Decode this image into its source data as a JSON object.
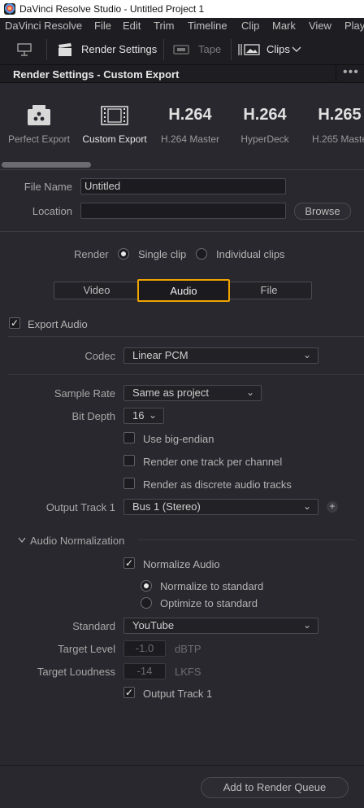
{
  "window": {
    "title": "DaVinci Resolve Studio - Untitled Project 1"
  },
  "menu": [
    "DaVinci Resolve",
    "File",
    "Edit",
    "Trim",
    "Timeline",
    "Clip",
    "Mark",
    "View",
    "Play"
  ],
  "toolbar": {
    "render_settings": "Render Settings",
    "tape": "Tape",
    "clips": "Clips"
  },
  "panel": {
    "title": "Render Settings - Custom Export",
    "more": "•••"
  },
  "presets": [
    {
      "label": "Perfect Export",
      "icon": "people-icon"
    },
    {
      "label": "Custom Export",
      "icon": "film-icon"
    },
    {
      "label": "H.264 Master",
      "big": "H.264"
    },
    {
      "label": "HyperDeck",
      "big": "H.264"
    },
    {
      "label": "H.265 Maste",
      "big": "H.265"
    }
  ],
  "file": {
    "name_label": "File Name",
    "name_value": "Untitled",
    "location_label": "Location",
    "location_value": "",
    "browse": "Browse"
  },
  "render": {
    "label": "Render",
    "single": "Single clip",
    "individual": "Individual clips",
    "selected": "single"
  },
  "tabs": {
    "video": "Video",
    "audio": "Audio",
    "file": "File",
    "active": "audio"
  },
  "audio": {
    "export_audio": "Export Audio",
    "codec_label": "Codec",
    "codec_value": "Linear PCM",
    "sample_rate_label": "Sample Rate",
    "sample_rate_value": "Same as project",
    "bit_depth_label": "Bit Depth",
    "bit_depth_value": "16",
    "big_endian": "Use big-endian",
    "one_track": "Render one track per channel",
    "discrete": "Render as discrete audio tracks",
    "output_track_label": "Output Track 1",
    "output_track_value": "Bus 1 (Stereo)",
    "add": "+"
  },
  "normalization": {
    "section": "Audio Normalization",
    "normalize": "Normalize Audio",
    "to_standard": "Normalize to standard",
    "optimize": "Optimize to standard",
    "standard_label": "Standard",
    "standard_value": "YouTube",
    "target_level_label": "Target Level",
    "target_level_value": "-1.0",
    "target_level_unit": "dBTP",
    "target_loudness_label": "Target Loudness",
    "target_loudness_value": "-14",
    "target_loudness_unit": "LKFS",
    "output_track": "Output Track 1"
  },
  "footer": {
    "add_queue": "Add to Render Queue"
  },
  "colors": {
    "accent": "#f0a400",
    "bg": "#28282e"
  }
}
